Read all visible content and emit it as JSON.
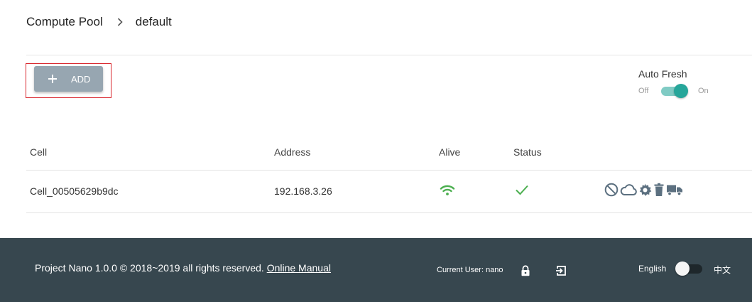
{
  "breadcrumb": {
    "root": "Compute Pool",
    "current": "default"
  },
  "toolbar": {
    "add_label": "ADD"
  },
  "auto_fresh": {
    "title": "Auto Fresh",
    "off_label": "Off",
    "on_label": "On",
    "enabled": true
  },
  "table": {
    "headers": {
      "cell": "Cell",
      "address": "Address",
      "alive": "Alive",
      "status": "Status"
    },
    "rows": [
      {
        "cell": "Cell_00505629b9dc",
        "address": "192.168.3.26",
        "alive_icon": "wifi-icon",
        "status_icon": "check-icon",
        "actions": [
          "disable-icon",
          "cloud-icon",
          "settings-icon",
          "delete-icon",
          "migrate-truck-icon"
        ]
      }
    ]
  },
  "footer": {
    "copyright": "Project Nano 1.0.0 © 2018~2019 all rights reserved.",
    "manual_link": "Online Manual",
    "current_user": "Current User: nano",
    "lang_en": "English",
    "lang_zh": "中文"
  },
  "colors": {
    "accent": "#26a69a",
    "alive": "#4caf50",
    "footer_bg": "#37474f",
    "add_button": "#97a6b1",
    "highlight": "#d8232a",
    "icon": "#5c7080"
  }
}
